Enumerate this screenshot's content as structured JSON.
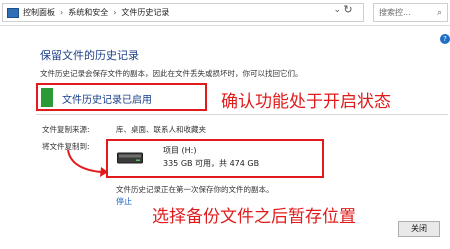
{
  "address_bar": {
    "breadcrumbs": [
      "控制面板",
      "系统和安全",
      "文件历史记录"
    ],
    "separator": "›",
    "dropdown_glyph": "⌄",
    "refresh_glyph": "↻"
  },
  "search": {
    "placeholder": "搜索控..."
  },
  "help_glyph": "?",
  "page": {
    "title": "保留文件的历史记录",
    "description": "文件历史记录会保存文件的副本，因此在文件丢失或损坏时，你可以找回它们。"
  },
  "status": {
    "text": "文件历史记录已启用",
    "swatch_color": "#2d9a38"
  },
  "details": {
    "source_label": "文件复制来源:",
    "source_value": "库、桌面、联系人和收藏夹",
    "dest_label": "将文件复制到:",
    "drive_name": "项目 (H:)",
    "drive_space": "335 GB 可用，共 474 GB",
    "copy_note": "文件历史记录正在第一次保存你的文件的副本。",
    "stop_link": "停止"
  },
  "annotations": {
    "confirm": "确认功能处于开启状态",
    "select": "选择备份文件之后暂存位置",
    "color": "#e11b1b"
  },
  "close_button": "关闭"
}
